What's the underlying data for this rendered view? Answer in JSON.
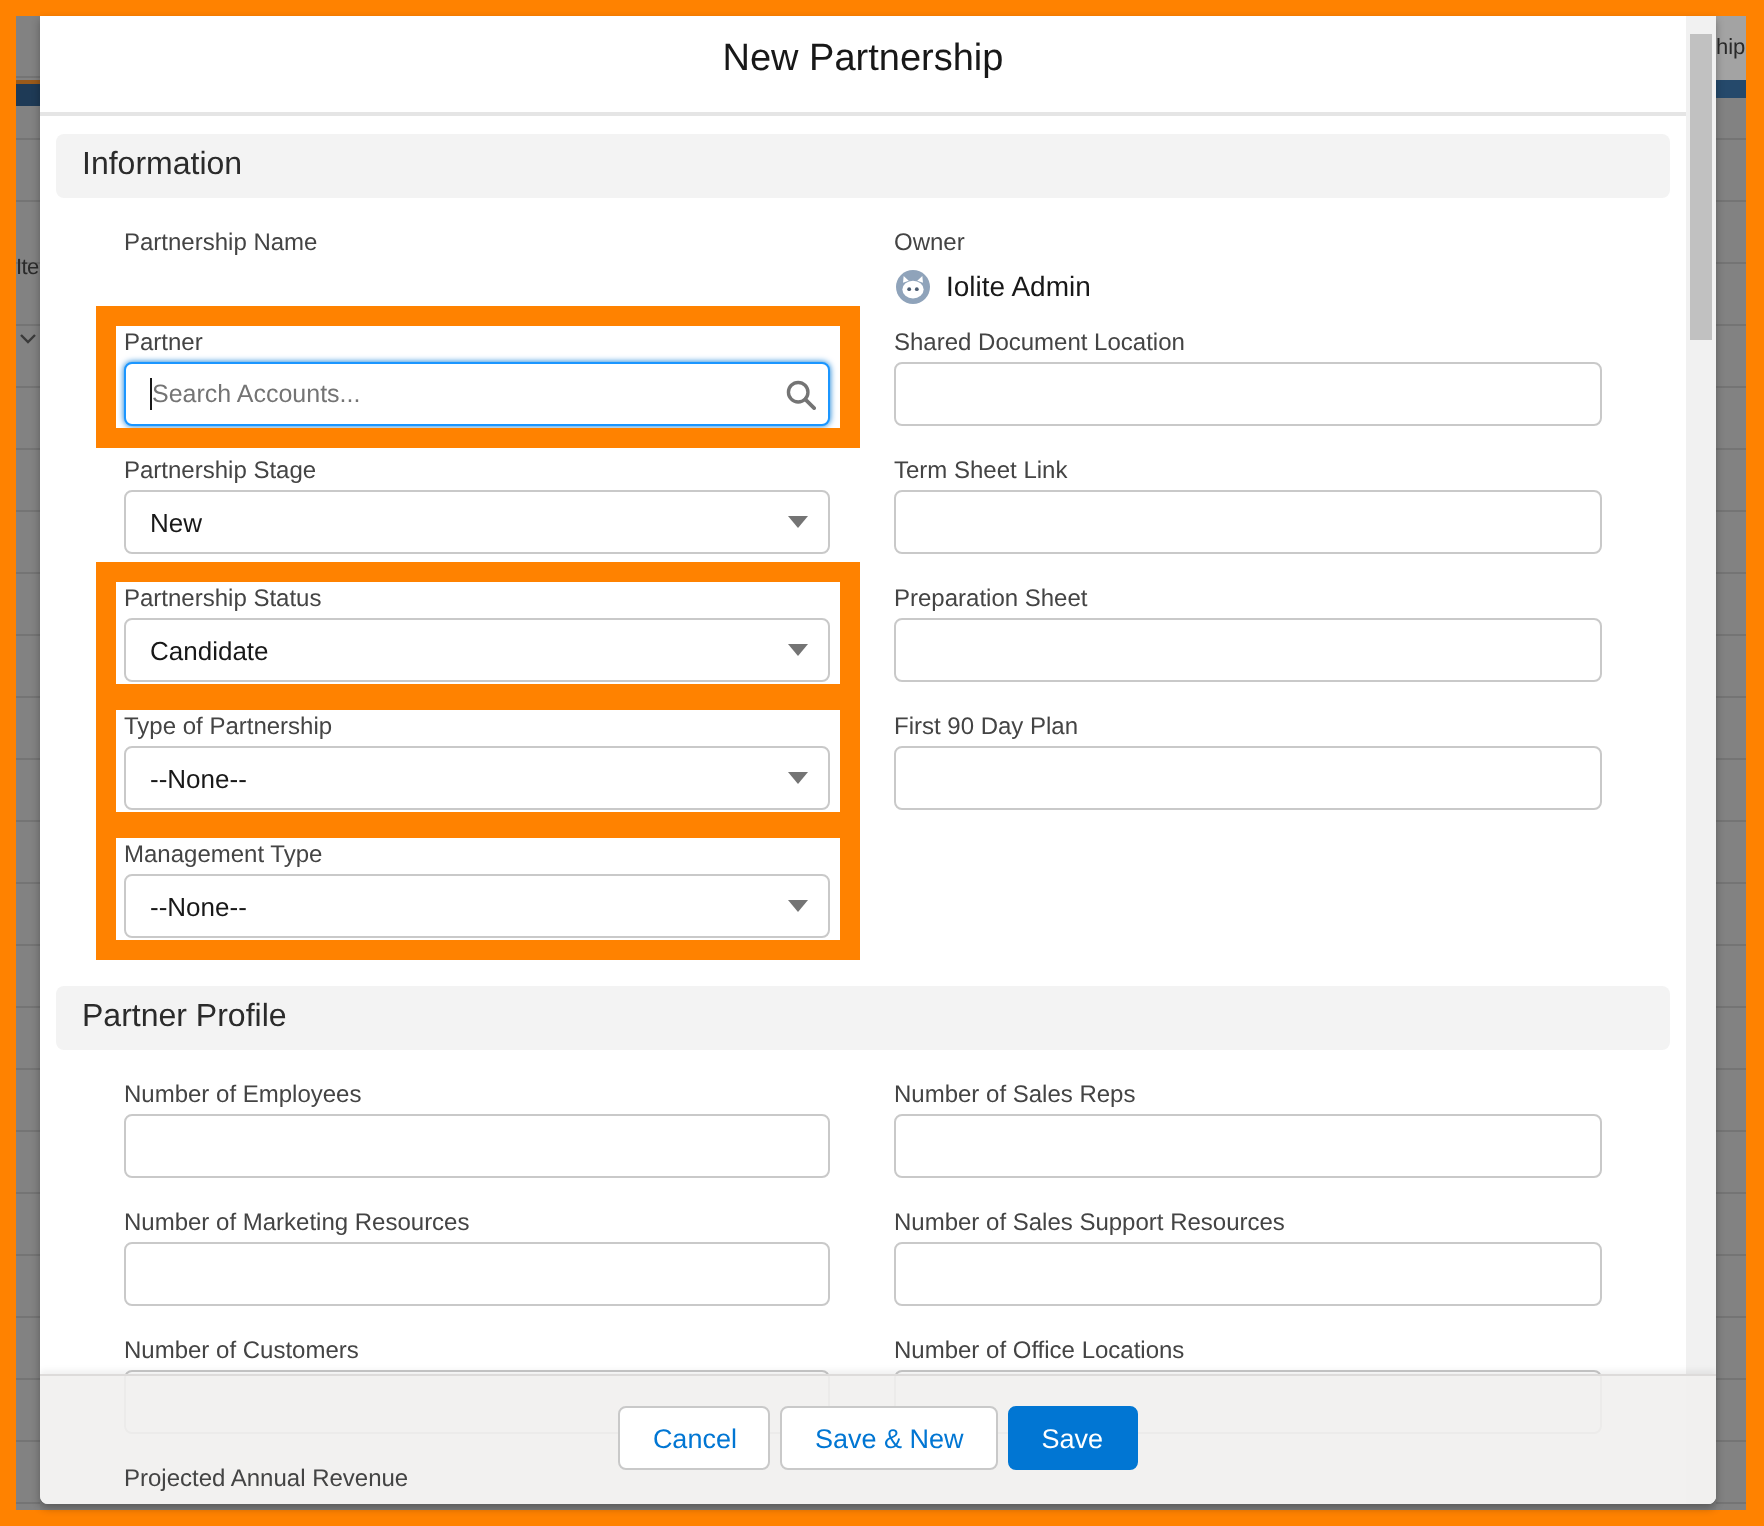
{
  "backdrop": {
    "left_text": "Ite",
    "right_text": "hip"
  },
  "modal": {
    "title": "New Partnership"
  },
  "sections": [
    {
      "title": "Information",
      "columns": [
        {
          "fields": [
            {
              "label": "Partnership Name",
              "kind": "display",
              "highlighted": false
            },
            {
              "label": "Partner",
              "kind": "lookup",
              "placeholder": "Search Accounts...",
              "focused": true,
              "highlighted": true
            },
            {
              "label": "Partnership Stage",
              "kind": "picklist",
              "value": "New",
              "focused": false,
              "highlighted": false
            },
            {
              "label": "Partnership Status",
              "kind": "picklist",
              "value": "Candidate",
              "focused": false,
              "highlighted": true
            },
            {
              "label": "Type of Partnership",
              "kind": "picklist",
              "value": "--None--",
              "focused": false,
              "highlighted": true
            },
            {
              "label": "Management Type",
              "kind": "picklist",
              "value": "--None--",
              "focused": false,
              "highlighted": true
            }
          ]
        },
        {
          "fields": [
            {
              "label": "Owner",
              "kind": "user",
              "value": "Iolite Admin",
              "highlighted": false
            },
            {
              "label": "Shared Document Location",
              "kind": "text",
              "focused": false,
              "highlighted": false
            },
            {
              "label": "Term Sheet Link",
              "kind": "text",
              "focused": false,
              "highlighted": false
            },
            {
              "label": "Preparation Sheet",
              "kind": "text",
              "focused": false,
              "highlighted": false
            },
            {
              "label": "First 90 Day Plan",
              "kind": "text",
              "focused": false,
              "highlighted": false
            }
          ]
        }
      ]
    },
    {
      "title": "Partner Profile",
      "columns": [
        {
          "fields": [
            {
              "label": "Number of Employees",
              "kind": "text",
              "focused": false,
              "highlighted": false
            },
            {
              "label": "Number of Marketing Resources",
              "kind": "text",
              "focused": false,
              "highlighted": false
            },
            {
              "label": "Number of Customers",
              "kind": "text",
              "focused": false,
              "highlighted": false
            },
            {
              "label": "Projected Annual Revenue",
              "kind": "display",
              "highlighted": false
            }
          ]
        },
        {
          "fields": [
            {
              "label": "Number of Sales Reps",
              "kind": "text",
              "focused": false,
              "highlighted": false
            },
            {
              "label": "Number of Sales Support Resources",
              "kind": "text",
              "focused": false,
              "highlighted": false
            },
            {
              "label": "Number of Office Locations",
              "kind": "text",
              "focused": false,
              "highlighted": false
            }
          ]
        }
      ]
    }
  ],
  "footer": {
    "buttons": [
      {
        "label": "Cancel",
        "kind": "neutral"
      },
      {
        "label": "Save & New",
        "kind": "neutral"
      },
      {
        "label": "Save",
        "kind": "brand"
      }
    ]
  }
}
